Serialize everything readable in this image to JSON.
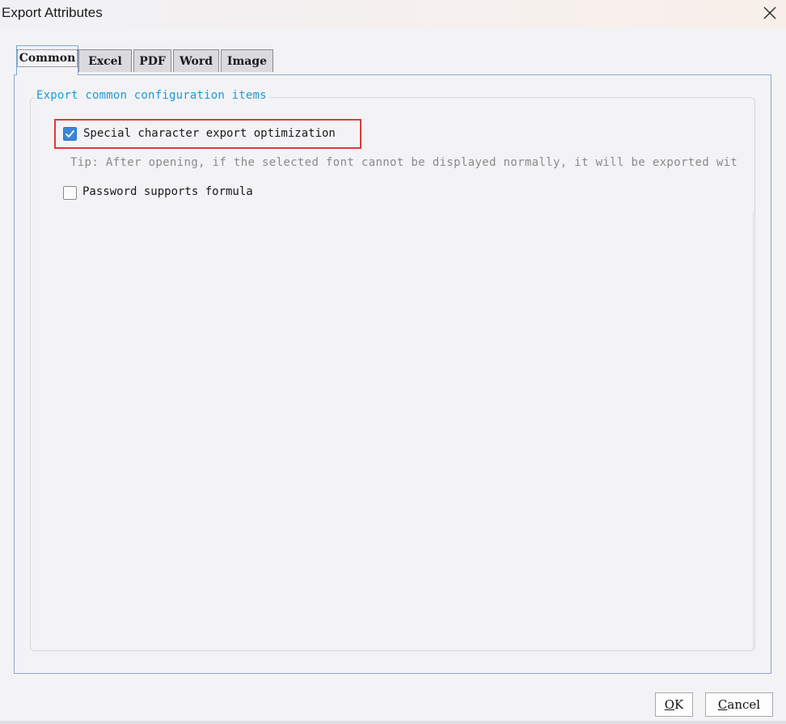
{
  "window": {
    "title": "Export Attributes",
    "close_label": "×"
  },
  "tabs": [
    {
      "label": "Common",
      "active": true
    },
    {
      "label": "Excel",
      "active": false
    },
    {
      "label": "PDF",
      "active": false
    },
    {
      "label": "Word",
      "active": false
    },
    {
      "label": "Image",
      "active": false
    }
  ],
  "group": {
    "title": "Export common configuration items"
  },
  "options": {
    "special_char": {
      "label": "Special character export optimization",
      "checked": true
    },
    "tip": "Tip: After opening, if the selected font cannot be displayed normally, it will be exported wit",
    "password_formula": {
      "label": "Password supports formula",
      "checked": false
    }
  },
  "buttons": {
    "ok": "OK",
    "cancel": "Cancel"
  },
  "colors": {
    "accent": "#3a86d8",
    "group_title": "#1c9ad6",
    "highlight": "#e03a3a",
    "tip": "#8a8a8a"
  },
  "icons": {
    "close": "close-icon",
    "check": "checkmark-icon"
  }
}
